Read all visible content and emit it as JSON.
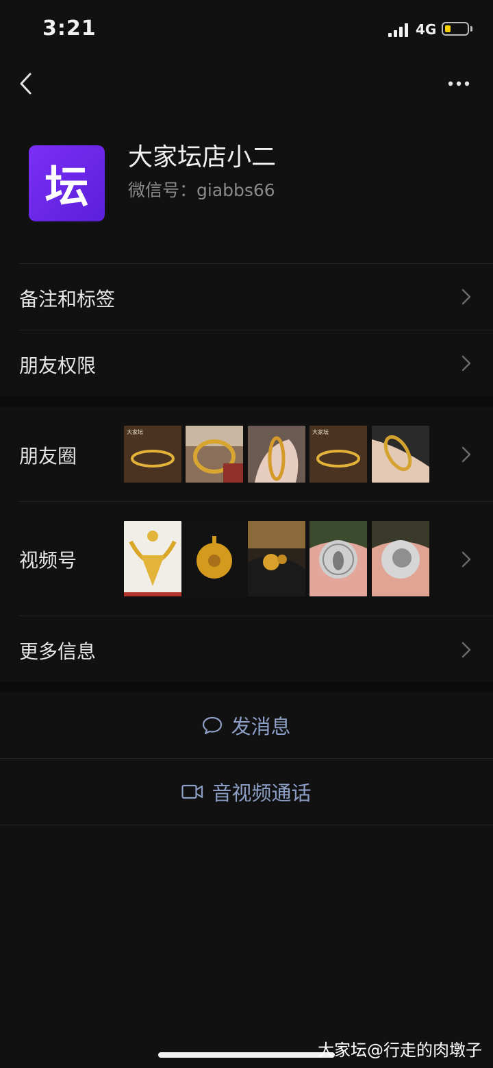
{
  "status_bar": {
    "time": "3:21",
    "network": "4G",
    "battery_level": 0.2,
    "signal_bars": 4
  },
  "profile": {
    "avatar_char": "坛",
    "name": "大家坛店小二",
    "wechat_id": "微信号：giabbs66"
  },
  "menu": {
    "notes_tags": "备注和标签",
    "friend_permissions": "朋友权限",
    "moments": "朋友圈",
    "channels": "视频号",
    "more_info": "更多信息"
  },
  "moments_thumbs": [
    "bangle-1",
    "bangle-2",
    "bangle-on-wrist",
    "bangle-3",
    "bangle-on-arm"
  ],
  "moments_thumb_caption": "大家坛",
  "channels_thumbs": [
    "gold-necklace-set",
    "gold-pendant",
    "gold-ring",
    "silver-coin-owl",
    "silver-coin-head"
  ],
  "actions": {
    "send_message": "发消息",
    "video_call": "音视频通话"
  },
  "watermark": "大家坛@行走的肉墩子",
  "colors": {
    "background": "#111111",
    "avatar_purple": "#6a25e8",
    "action_text": "#8d9fc6",
    "battery_fill": "#f5d100"
  }
}
